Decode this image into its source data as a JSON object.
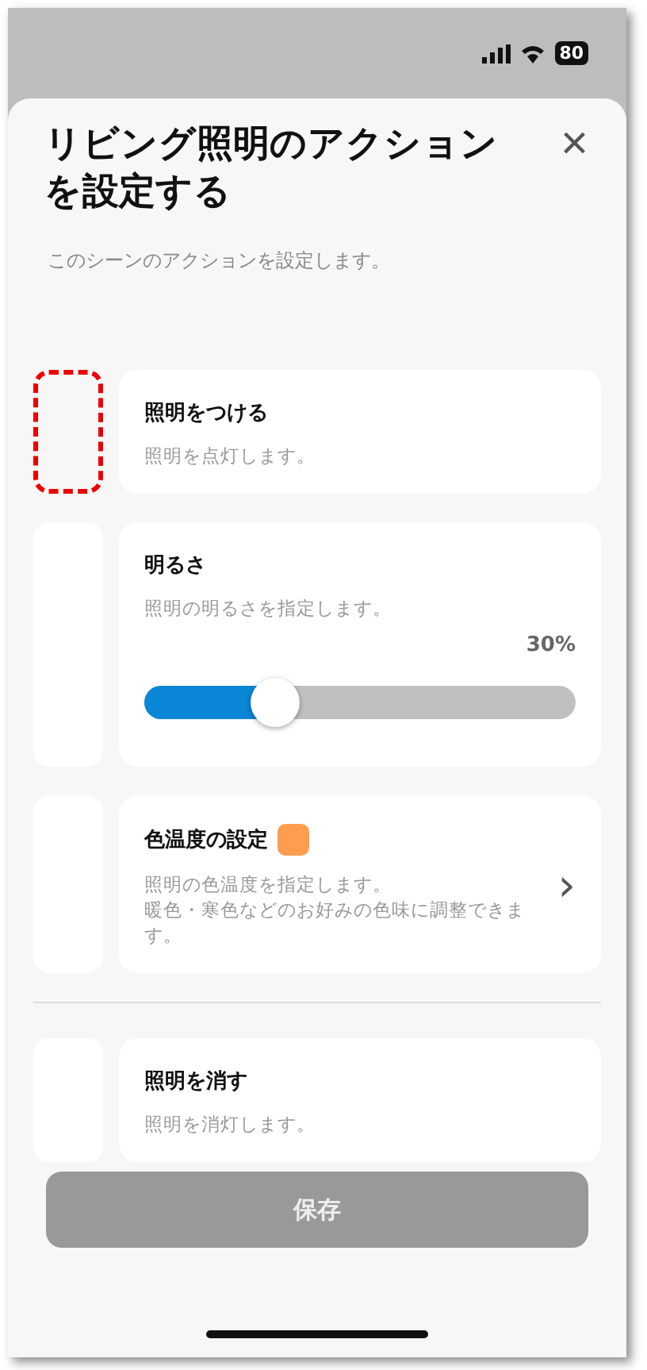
{
  "status_bar": {
    "battery": "80"
  },
  "dialog": {
    "title": "リビング照明のアクションを設定する",
    "subtitle": "このシーンのアクションを設定します。",
    "close": "×"
  },
  "actions": [
    {
      "kind": "plain",
      "title": "照明をつける",
      "description": "照明を点灯します。",
      "selected": true
    },
    {
      "kind": "slider",
      "title": "明るさ",
      "description": "照明の明るさを指定します。",
      "reading": "30%",
      "level": 0.3,
      "selected": false
    },
    {
      "kind": "color",
      "title": "色温度の設定",
      "description": [
        "照明の色温度を指定します。",
        "暖色・寒色などのお好みの色味に調整できます。"
      ],
      "color": "#ff9d4f",
      "chevron": "›",
      "selected": false
    }
  ],
  "end_actions": [
    {
      "kind": "plain",
      "title": "照明を消す",
      "description": "照明を消灯します。",
      "selected": false
    }
  ],
  "save_button": {
    "label": "保存",
    "disabled": true
  }
}
